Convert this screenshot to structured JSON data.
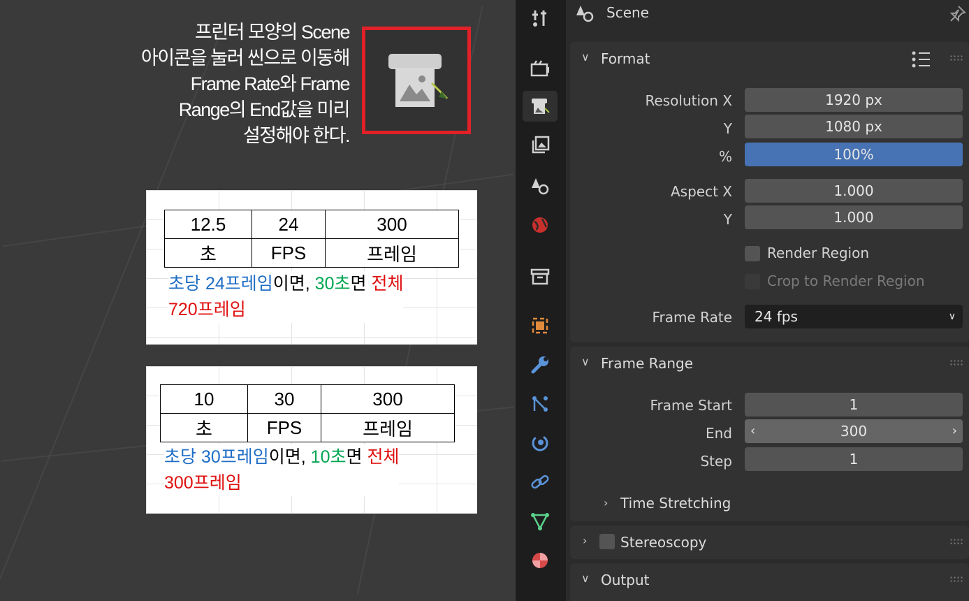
{
  "annotation": {
    "lines": [
      "프린터 모양의 Scene",
      "아이콘을 눌러 씬으로 이동해",
      "Frame Rate와 Frame",
      "Range의 End값을 미리",
      "설정해야 한다."
    ]
  },
  "example1": {
    "row1": [
      "12.5",
      "24",
      "300"
    ],
    "row2": [
      "초",
      "FPS",
      "프레임"
    ],
    "note_parts": [
      "초당 24프레임",
      "이면, ",
      "30초",
      "면 ",
      "전체",
      "720프레임"
    ]
  },
  "example2": {
    "row1": [
      "10",
      "30",
      "300"
    ],
    "row2": [
      "초",
      "FPS",
      "프레임"
    ],
    "note_parts": [
      "초당 30프레임",
      "이면, ",
      "10초",
      "면 ",
      "전체",
      "300프레임"
    ]
  },
  "colors": {
    "callout_border": "#e12127",
    "green": "#00a651",
    "blue": "#1f6ec6",
    "red": "#e01010",
    "selected_field": "#4772b3"
  },
  "tabs": [
    "tool-icon",
    "render-icon",
    "output-icon",
    "view-layer-icon",
    "scene-icon",
    "world-icon",
    "collection-icon",
    "object-icon",
    "modifier-icon",
    "particles-icon",
    "physics-icon",
    "constraints-icon",
    "data-icon",
    "material-icon"
  ],
  "active_tab": "output-icon",
  "header": {
    "title": "Scene"
  },
  "format": {
    "title": "Format",
    "resolution_x_label": "Resolution X",
    "resolution_x": "1920 px",
    "resolution_y_label": "Y",
    "resolution_y": "1080 px",
    "percent_label": "%",
    "percent": "100%",
    "aspect_x_label": "Aspect X",
    "aspect_x": "1.000",
    "aspect_y_label": "Y",
    "aspect_y": "1.000",
    "render_region": "Render Region",
    "crop_region": "Crop to Render Region",
    "frame_rate_label": "Frame Rate",
    "frame_rate": "24 fps"
  },
  "frame_range": {
    "title": "Frame Range",
    "start_label": "Frame Start",
    "start": "1",
    "end_label": "End",
    "end": "300",
    "step_label": "Step",
    "step": "1",
    "time_stretching": "Time Stretching"
  },
  "stereoscopy": {
    "title": "Stereoscopy"
  },
  "output": {
    "title": "Output"
  }
}
